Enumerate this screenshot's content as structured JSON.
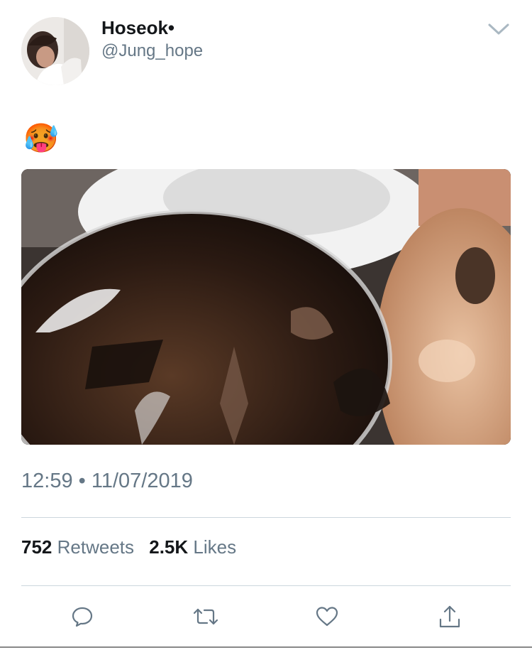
{
  "author": {
    "display_name": "Hoseok•",
    "handle": "@Jung_hope",
    "avatar_icon": "profile-photo"
  },
  "tweet": {
    "text": "🥵",
    "media_icon": "photo-iced-coffee-drinks",
    "timestamp": "12:59 • 11/07/2019"
  },
  "stats": {
    "retweets_count": "752",
    "retweets_label": "Retweets",
    "likes_count": "2.5K",
    "likes_label": "Likes"
  },
  "actions": [
    {
      "name": "reply",
      "icon": "speech-bubble-icon"
    },
    {
      "name": "retweet",
      "icon": "retweet-icon"
    },
    {
      "name": "like",
      "icon": "heart-icon"
    },
    {
      "name": "share",
      "icon": "share-upload-icon"
    }
  ],
  "menu": {
    "icon": "chevron-down-icon"
  },
  "colors": {
    "primary_text": "#14171a",
    "secondary_text": "#657786",
    "divider": "#ccd6dd",
    "icon": "#657786"
  }
}
